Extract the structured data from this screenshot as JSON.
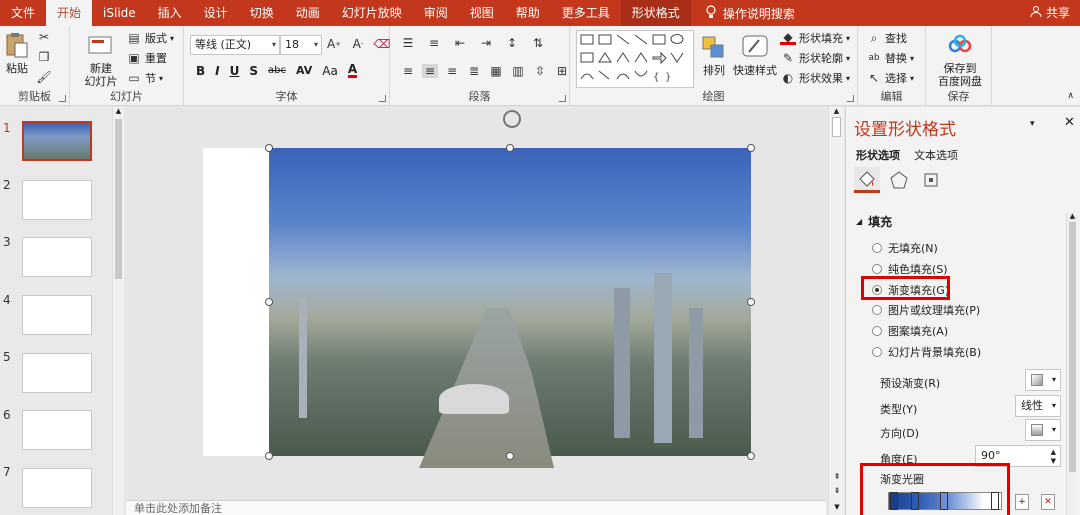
{
  "menu": {
    "tabs": [
      "文件",
      "开始",
      "iSlide",
      "插入",
      "设计",
      "切换",
      "动画",
      "幻灯片放映",
      "审阅",
      "视图",
      "帮助",
      "更多工具",
      "形状格式"
    ],
    "active_tab": "开始",
    "context_tab": "形状格式",
    "search_label": "操作说明搜索",
    "share_label": "共享"
  },
  "ribbon": {
    "clipboard": {
      "label": "剪贴板",
      "paste": "粘贴"
    },
    "slides": {
      "label": "幻灯片",
      "new_slide": "新建\n幻灯片",
      "layout": "版式",
      "reset": "重置",
      "section": "节"
    },
    "font": {
      "label": "字体",
      "font_name": "等线 (正文)",
      "font_size": "18",
      "bold": "B",
      "italic": "I",
      "underline": "U",
      "shadow": "S",
      "strike": "abc",
      "spacing": "AV",
      "case": "Aa",
      "color": "A"
    },
    "paragraph": {
      "label": "段落"
    },
    "drawing": {
      "label": "绘图",
      "arrange": "排列",
      "quick_styles": "快速样式",
      "shape_fill": "形状填充",
      "shape_outline": "形状轮廓",
      "shape_effects": "形状效果"
    },
    "editing": {
      "label": "编辑",
      "find": "查找",
      "replace": "替换",
      "select": "选择"
    },
    "save": {
      "label": "保存",
      "save_to_baidu": "保存到\n百度网盘"
    }
  },
  "thumbnails": {
    "numbers": [
      "1",
      "2",
      "3",
      "4",
      "5",
      "6",
      "7"
    ],
    "selected": 1
  },
  "notes_placeholder": "单击此处添加备注",
  "pane": {
    "title": "设置形状格式",
    "tabs": [
      "形状选项",
      "文本选项"
    ],
    "section": "填充",
    "fill_options": [
      {
        "label": "无填充(N)",
        "selected": false
      },
      {
        "label": "纯色填充(S)",
        "selected": false
      },
      {
        "label": "渐变填充(G)",
        "selected": true
      },
      {
        "label": "图片或纹理填充(P)",
        "selected": false
      },
      {
        "label": "图案填充(A)",
        "selected": false
      },
      {
        "label": "幻灯片背景填充(B)",
        "selected": false
      }
    ],
    "preset_gradient_label": "预设渐变(R)",
    "type_label": "类型(Y)",
    "type_value": "线性",
    "direction_label": "方向(D)",
    "angle_label": "角度(E)",
    "angle_value": "90°",
    "gradient_stops_label": "渐变光圈"
  },
  "colors": {
    "accent": "#c3371d",
    "highlight": "#e00000"
  }
}
